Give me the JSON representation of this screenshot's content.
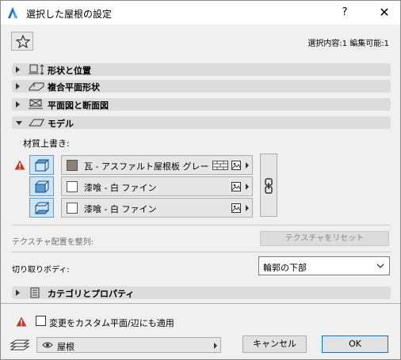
{
  "window": {
    "title": "選択した屋根の設定",
    "help_label": "?",
    "close_label": "✕"
  },
  "header": {
    "selection_info": "選択内容:1 編集可能:1"
  },
  "sections": [
    {
      "label": "形状と位置",
      "expanded": false,
      "icon": "shape-position-icon"
    },
    {
      "label": "複合平面形状",
      "expanded": false,
      "icon": "complex-plane-icon"
    },
    {
      "label": "平面図と断面図",
      "expanded": false,
      "icon": "plan-section-icon"
    },
    {
      "label": "モデル",
      "expanded": true,
      "icon": "model-icon"
    }
  ],
  "model": {
    "override_label": "材質上書き:",
    "materials": [
      {
        "name": "瓦 - アスファルト屋根板 グレー",
        "swatch_color": "#8a8178",
        "has_hatch": true,
        "warning": true
      },
      {
        "name": "漆喰 - 白 ファイン",
        "swatch_color": "#ffffff",
        "has_hatch": false,
        "warning": false
      },
      {
        "name": "漆喰 - 白 ファイン",
        "swatch_color": "#ffffff",
        "has_hatch": false,
        "warning": false
      }
    ],
    "texture_align_label": "テクスチャ配置を整列:",
    "texture_reset_label": "テクスチャをリセット",
    "cut_body_label": "切り取りボディ:",
    "cut_body_value": "輪郭の下部"
  },
  "category_section": {
    "label": "カテゴリとプロパティ",
    "expanded": false
  },
  "footer": {
    "apply_label": "変更をカスタム平面/辺にも適用",
    "layer_value": "屋根",
    "cancel_label": "キャンセル",
    "ok_label": "OK"
  },
  "colors": {
    "accent": "#0078d7",
    "warning": "#c0392b",
    "section_bg": "#dcdcdc"
  }
}
